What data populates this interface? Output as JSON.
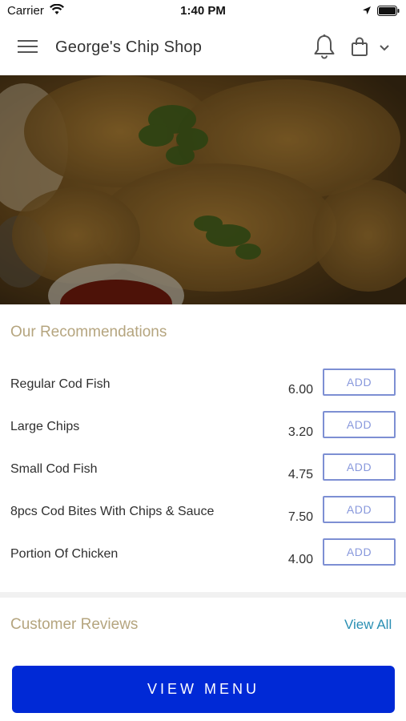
{
  "status_bar": {
    "carrier": "Carrier",
    "time": "1:40 PM"
  },
  "header": {
    "title": "George's Chip Shop",
    "icons": [
      "hamburger-menu-icon",
      "bell-icon",
      "shopping-bag-icon",
      "chevron-down-icon"
    ]
  },
  "hero": {
    "image": "fried-fish-photo"
  },
  "recommendations": {
    "title": "Our Recommendations",
    "items": [
      {
        "name": "Regular Cod Fish",
        "price": "6.00",
        "button": "ADD"
      },
      {
        "name": "Large Chips",
        "price": "3.20",
        "button": "ADD"
      },
      {
        "name": "Small Cod Fish",
        "price": "4.75",
        "button": "ADD"
      },
      {
        "name": "8pcs Cod Bites With Chips & Sauce",
        "price": "7.50",
        "button": "ADD"
      },
      {
        "name": "Portion Of Chicken",
        "price": "4.00",
        "button": "ADD"
      }
    ]
  },
  "reviews": {
    "title": "Customer Reviews",
    "view_all": "View All"
  },
  "footer": {
    "view_menu": "VIEW MENU"
  },
  "colors": {
    "accent_gold": "#b5a57f",
    "link_blue": "#2a8fb3",
    "primary_button": "#0029d6",
    "add_button_border": "#7d8fd3"
  }
}
